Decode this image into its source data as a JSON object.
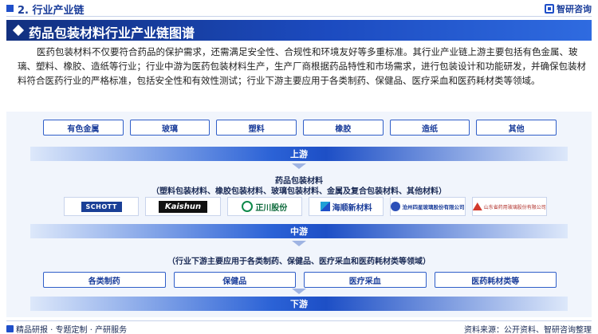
{
  "header": {
    "section_title": "2. 行业产业链",
    "brand_name": "智研咨询"
  },
  "banner": {
    "title": "药品包装材料行业产业链图谱"
  },
  "intro_text": "医药包装材料不仅要符合药品的保护需求，还需满足安全性、合规性和环境友好等多重标准。其行业产业链上游主要包括有色金属、玻璃、塑料、橡胶、造纸等行业；行业中游为医药包装材料生产，生产厂商根据药品特性和市场需求，进行包装设计和功能研发，并确保包装材料符合医药行业的严格标准，包括安全性和有效性测试；行业下游主要应用于各类制药、保健品、医疗采血和医药耗材类等领域。",
  "upstream": {
    "items": [
      "有色金属",
      "玻璃",
      "塑料",
      "橡胶",
      "造纸",
      "其他"
    ],
    "stage_label": "上游"
  },
  "midstream": {
    "title": "药品包装材料",
    "subtitle": "（塑料包装材料、橡胶包装材料、玻璃包装材料、金属及复合包装材料、其他材料）",
    "logos": [
      {
        "text": "SCHOTT",
        "icon": "schott-logo"
      },
      {
        "text": "Kaishun",
        "icon": "kaishun-logo"
      },
      {
        "text": "正川股份",
        "icon": "zhengchuan-logo"
      },
      {
        "text": "海顺新材料",
        "icon": "haishun-logo"
      },
      {
        "text": "沧州四星玻璃股份有限公司",
        "icon": "sixing-glass-logo"
      },
      {
        "text": "山东省药用玻璃股份有限公司",
        "icon": "shandong-glass-logo"
      }
    ],
    "stage_label": "中游"
  },
  "downstream": {
    "note": "（行业下游主要应用于各类制药、保健品、医疗采血和医药耗材类等领域）",
    "items": [
      "各类制药",
      "保健品",
      "医疗采血",
      "医药耗材类等"
    ],
    "stage_label": "下游"
  },
  "footer": {
    "left": "精品研报 · 专题定制 · 产研服务",
    "right": "资料来源：公开资料、智研咨询整理"
  },
  "colors": {
    "primary": "#1f4fc9",
    "dark": "#12307f",
    "panel": "#f1f5fc"
  }
}
